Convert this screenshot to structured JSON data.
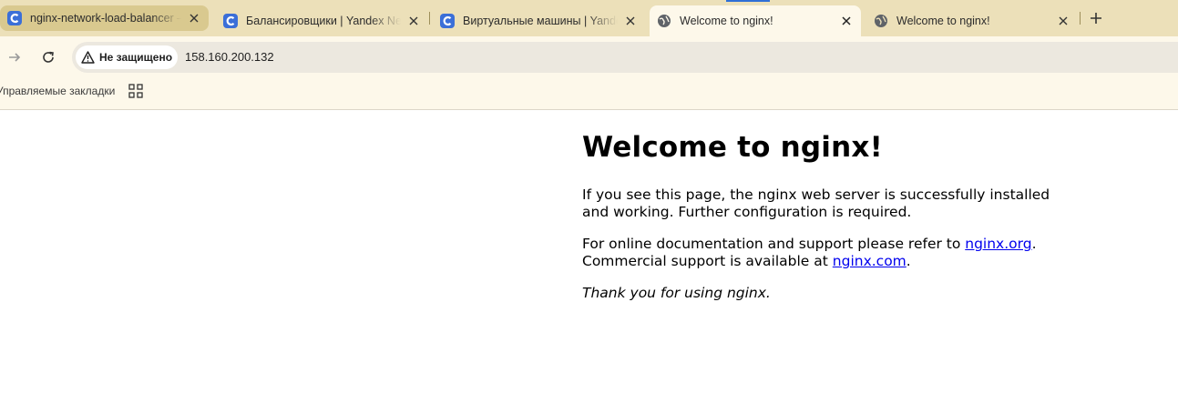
{
  "browser": {
    "tabs": [
      {
        "title": "nginx-network-load-balancer — ",
        "icon": "yandex-cloud-icon",
        "state": "highlighted"
      },
      {
        "title": "Балансировщики | Yandex Network",
        "icon": "yandex-cloud-icon",
        "state": "normal"
      },
      {
        "title": "Виртуальные машины | Yandex Cloud",
        "icon": "yandex-cloud-icon",
        "state": "normal"
      },
      {
        "title": "Welcome to nginx!",
        "icon": "globe-icon",
        "state": "active"
      },
      {
        "title": "Welcome to nginx!",
        "icon": "globe-icon",
        "state": "normal"
      }
    ],
    "new_tab_icon": "plus-icon",
    "toolbar": {
      "security_label": "Не защищено",
      "url": "158.160.200.132"
    },
    "bookmarks": {
      "managed_label": "Управляемые закладки",
      "apps_icon": "apps-grid-icon"
    },
    "colors": {
      "tabstrip": "#ece0b9",
      "active_tab": "#fdf8ea",
      "link": "#0000ee"
    }
  },
  "page": {
    "heading": "Welcome to nginx!",
    "para1": "If you see this page, the nginx web server is successfully installed and working. Further configuration is required.",
    "para2_prefix": "For online documentation and support please refer to ",
    "link1": "nginx.org",
    "para2_mid": ".",
    "para2_line2": "Commercial support is available at ",
    "link2": "nginx.com",
    "para2_end": ".",
    "thanks": "Thank you for using nginx."
  }
}
